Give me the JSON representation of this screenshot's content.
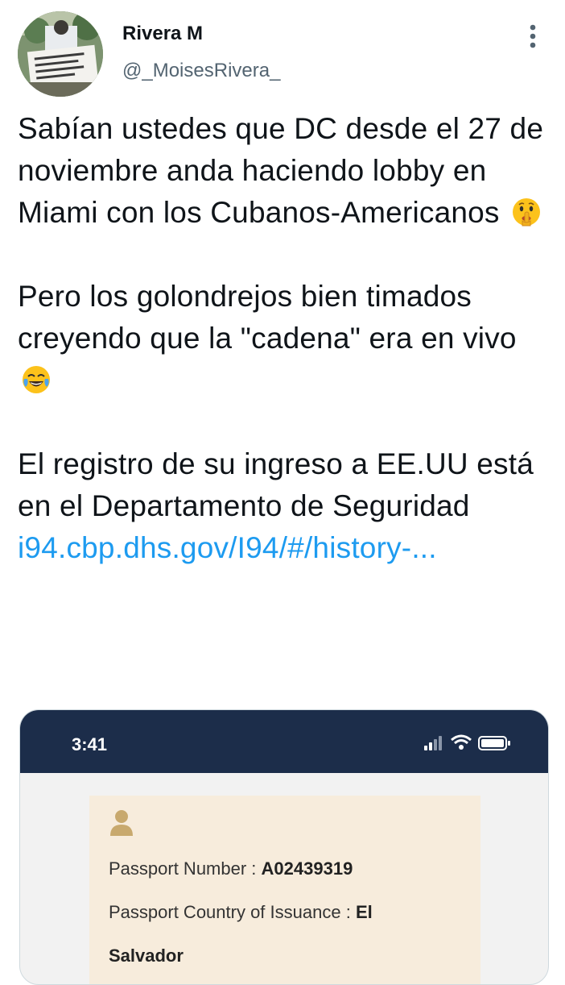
{
  "tweet": {
    "author": {
      "display_name": "Rivera M",
      "handle": "@_MoisesRivera_"
    },
    "paragraphs": [
      {
        "text": "Sabían ustedes que DC desde el 27 de noviembre anda haciendo lobby en Miami con los Cubanos-Americanos",
        "emoji": "shushing-face"
      },
      {
        "text": "Pero los golondrejos bien timados creyendo que la \"cadena\" era en vivo",
        "emoji": "face-with-tears-of-joy"
      },
      {
        "text": "El registro de su ingreso a EE.UU está en el Departamento de Seguridad",
        "link": "i94.cbp.dhs.gov/I94/#/history-..."
      }
    ],
    "colors": {
      "text": "#0f1419",
      "secondary": "#536471",
      "link": "#1d9bf0"
    }
  },
  "media": {
    "status_bar": {
      "time": "3:41"
    },
    "record": {
      "passport_number_label": "Passport Number :",
      "passport_number_value": "A02439319",
      "country_label": "Passport Country of Issuance :",
      "country_value_line1": "El",
      "country_value_line2": "Salvador"
    },
    "colors": {
      "status_bar": "#1c2d4a",
      "panel": "#f7ecdc",
      "icon": "#c8a96e"
    }
  },
  "icons": {
    "more": "more-icon",
    "signal": "signal-icon",
    "wifi": "wifi-icon",
    "battery": "battery-icon",
    "person": "person-icon"
  }
}
